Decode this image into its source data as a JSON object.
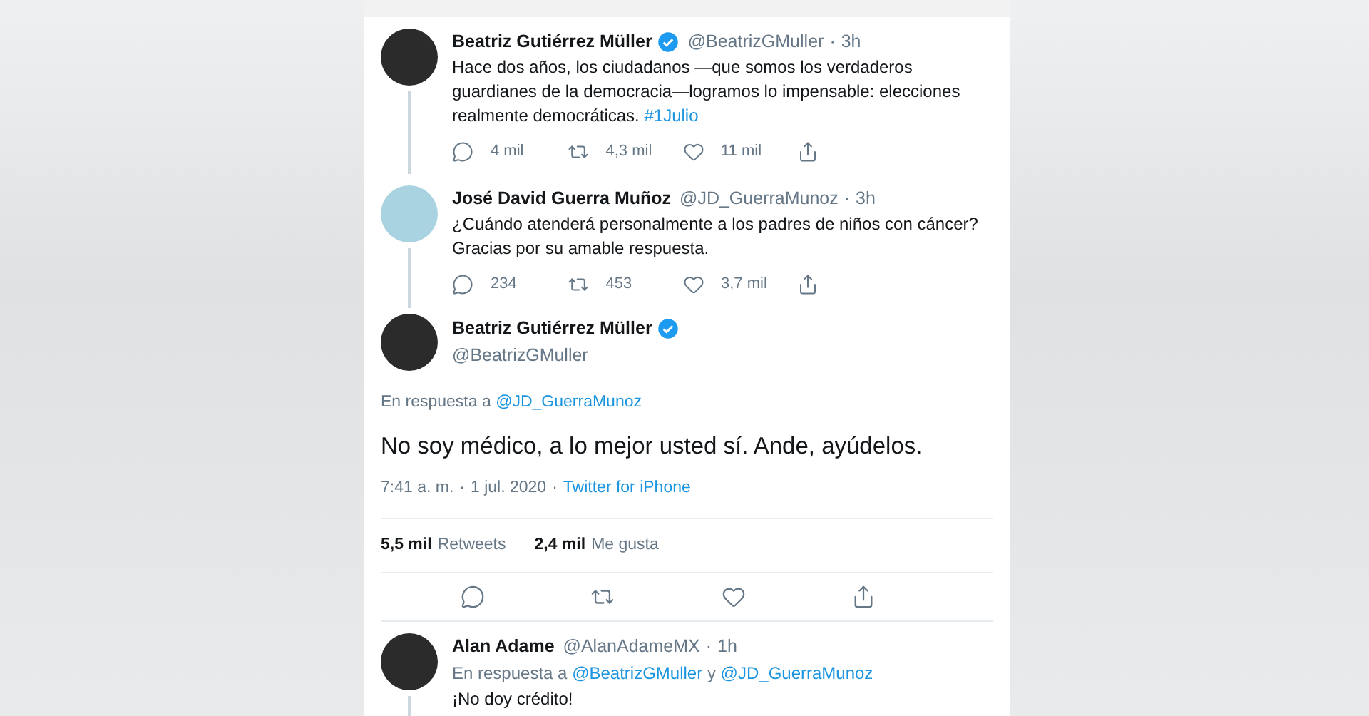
{
  "thread": [
    {
      "name": "Beatriz Gutiérrez Müller",
      "verified": true,
      "handle": "@BeatrizGMuller",
      "separator": "·",
      "time": "3h",
      "text": "Hace dos años, los ciudadanos —que somos los verdaderos guardianes de la democracia—logramos lo impensable: elecciones realmente democráticas.",
      "hashtag": "#1Julio",
      "actions": [
        {
          "kind": "reply",
          "count": "4 mil"
        },
        {
          "kind": "retweet",
          "count": "4,3 mil"
        },
        {
          "kind": "like",
          "count": "11 mil"
        },
        {
          "kind": "share"
        }
      ]
    },
    {
      "name": "José David Guerra Muñoz",
      "verified": false,
      "handle": "@JD_GuerraMunoz",
      "separator": "·",
      "time": "3h",
      "text": "¿Cuándo atenderá personalmente a los padres de niños con cáncer? Gracias por su amable respuesta.",
      "actions": [
        {
          "kind": "reply",
          "count": "234"
        },
        {
          "kind": "retweet",
          "count": "453"
        },
        {
          "kind": "like",
          "count": "3,7 mil"
        },
        {
          "kind": "share"
        }
      ]
    }
  ],
  "main_tweet": {
    "name": "Beatriz Gutiérrez Müller",
    "verified": true,
    "handle": "@BeatrizGMuller",
    "reply_label": "En respuesta a",
    "mentions": [
      "@JD_GuerraMunoz"
    ],
    "text": "No soy médico, a lo mejor usted sí. Ande, ayúdelos.",
    "time": "7:41 a. m.",
    "separator": "·",
    "date": "1 jul. 2020",
    "source": "Twitter for iPhone",
    "stats": [
      {
        "count": "5,5 mil",
        "label": "Retweets"
      },
      {
        "count": "2,4 mil",
        "label": "Me gusta"
      }
    ],
    "actions": [
      {
        "kind": "reply"
      },
      {
        "kind": "retweet"
      },
      {
        "kind": "like"
      },
      {
        "kind": "share"
      }
    ]
  },
  "reply": {
    "name": "Alan Adame",
    "verified": false,
    "handle": "@AlanAdameMX",
    "separator": "·",
    "time": "1h",
    "reply_label": "En respuesta a",
    "mentions": [
      "@BeatrizGMuller",
      "@JD_GuerraMunoz"
    ],
    "joiner": "y",
    "text": "¡No doy crédito!"
  }
}
